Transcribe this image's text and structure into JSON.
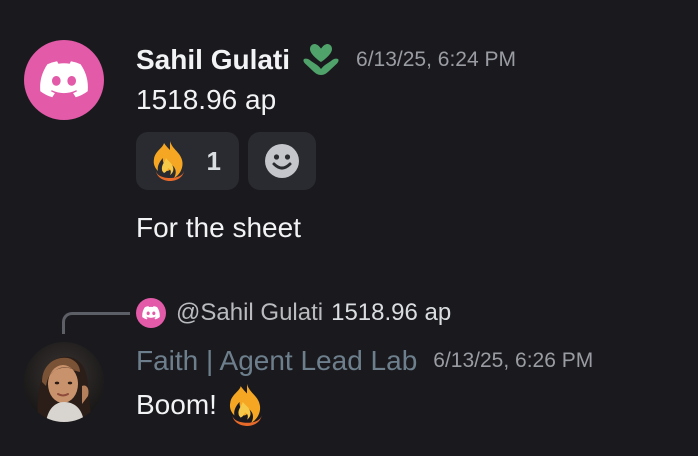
{
  "messages": [
    {
      "author": "Sahil Gulati",
      "timestamp": "6/13/25, 6:24 PM",
      "role_icon": "green-heart-hands-icon",
      "lines": [
        "1518.96 ap",
        "For the sheet"
      ],
      "reactions": [
        {
          "emoji": "fire",
          "count": "1"
        },
        {
          "emoji": "add-reaction-smiley",
          "count": ""
        }
      ],
      "avatar": "discord-logo-icon"
    },
    {
      "reply_to": {
        "mention": "@Sahil Gulati",
        "content": "1518.96 ap"
      },
      "author": "Faith | Agent Lead Lab",
      "timestamp": "6/13/25, 6:26 PM",
      "text": "Boom!",
      "inline_emoji": "fire",
      "avatar": "user-photo"
    }
  ],
  "colors": {
    "background": "#1a1a1e",
    "discord_pink": "#e25aa8",
    "role_green": "#4fa36a",
    "reaction_bg": "#2a2b30",
    "muted_text": "#9a9ca3",
    "author2_color": "#6d7f8c"
  }
}
